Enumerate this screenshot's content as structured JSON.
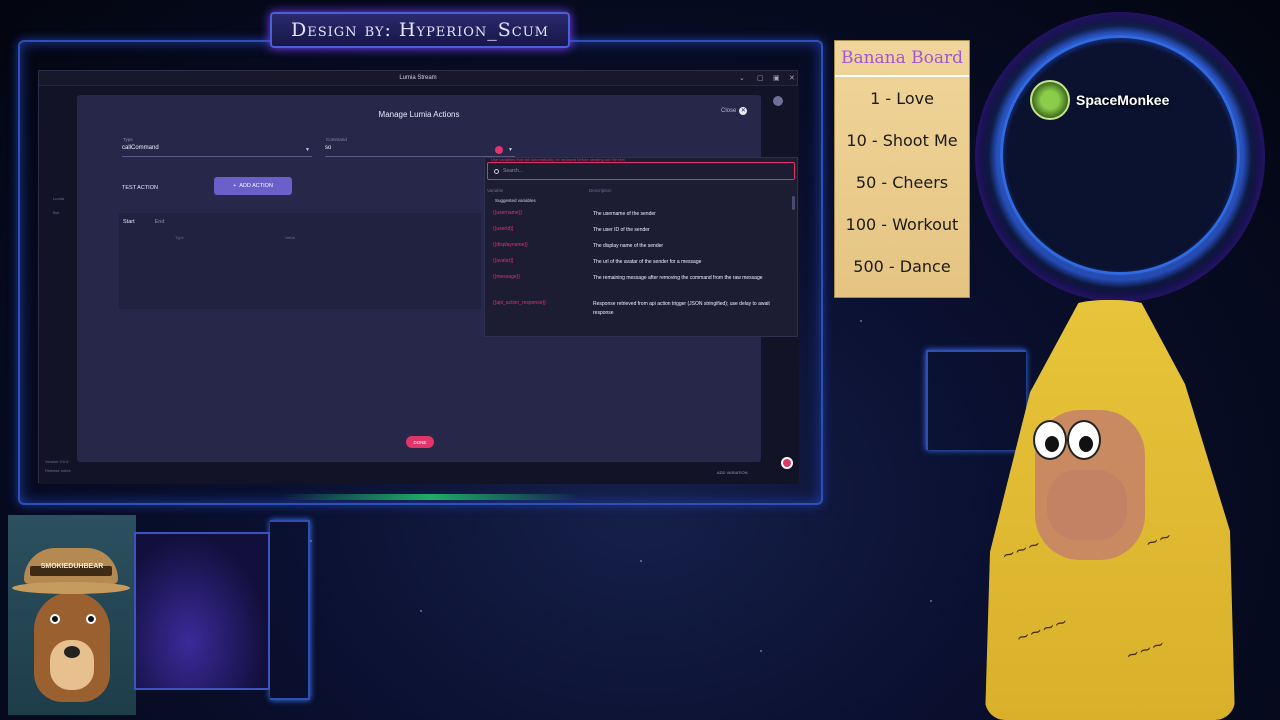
{
  "overlay": {
    "design_credit": "Design by: Hyperion_Scum",
    "banana_board": {
      "title": "Banana Board",
      "items": [
        "1 - Love",
        "10 - Shoot Me",
        "50 - Cheers",
        "100 - Workout",
        "500 - Dance"
      ]
    },
    "viewer_name": "SpaceMonkee",
    "webcam_hat_text": "SMOKIEDUHBEAR"
  },
  "window": {
    "title": "Lumia Stream"
  },
  "modal": {
    "title": "Manage Lumia Actions",
    "close_label": "Close",
    "type_label": "Type",
    "type_value": "callCommand",
    "command_label": "Command",
    "command_value": "so",
    "test_action": "TEST ACTION",
    "add_action": "ADD ACTION",
    "tab_start": "Start",
    "tab_end": "End",
    "col_type": "Type",
    "col_value": "Value",
    "done": "DONE"
  },
  "variables_panel": {
    "hint": "Use variables that will automatically be replaced before sending out the text",
    "search_placeholder": "Search...",
    "col_variable": "Variable",
    "col_description": "Description",
    "suggested_header": "Suggested variables",
    "rows": [
      {
        "name": "{{username}}",
        "desc": "The username of the sender"
      },
      {
        "name": "{{userId}}",
        "desc": "The user ID of the sender"
      },
      {
        "name": "{{displayname}}",
        "desc": "The display name of the sender"
      },
      {
        "name": "{{avatar}}",
        "desc": "The url of the avatar of the sender for a message"
      },
      {
        "name": "{{message}}",
        "desc": "The remaining message after removing the command from the raw message"
      },
      {
        "name": "{{api_action_response}}",
        "desc": "Response retrieved from api action trigger (JSON stringified); use delay to await response"
      }
    ]
  },
  "background_window": {
    "side_items": [
      "Lumia",
      "Bot"
    ],
    "version": "Version 9.0.0",
    "release": "Release notes",
    "add_variation": "ADD VARIATION"
  },
  "colors": {
    "accent_pink": "#e0346b",
    "button_purple": "#6a60c9",
    "modal_bg": "#27274a",
    "banana_title": "#a355d8"
  }
}
